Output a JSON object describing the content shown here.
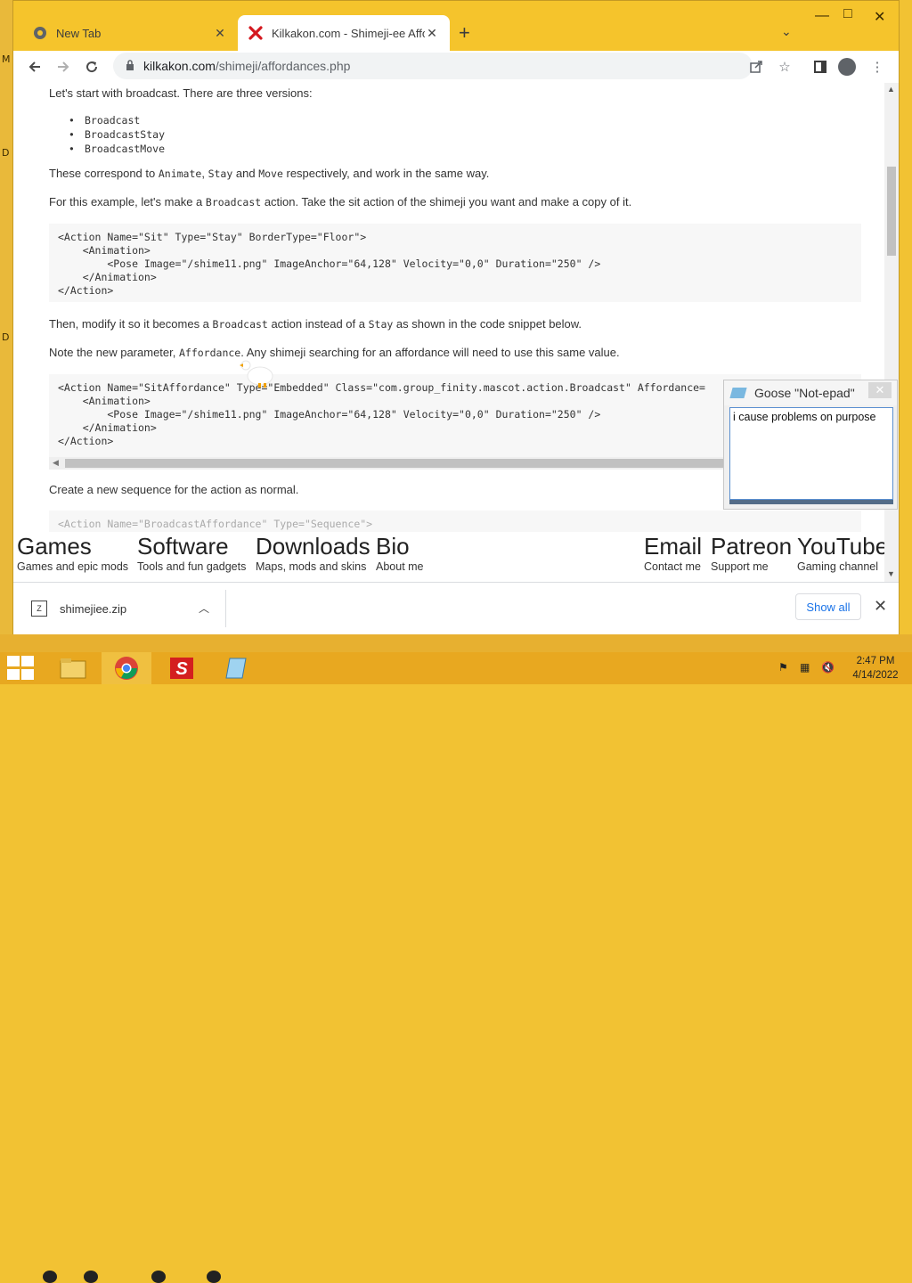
{
  "desktop": {
    "left_letters": [
      "M",
      "D",
      "D"
    ]
  },
  "window": {
    "controls": {
      "minimize": "—",
      "maximize": "□",
      "close": "✕"
    }
  },
  "tabs": [
    {
      "title": "New Tab",
      "favicon": "chrome-icon",
      "close": "✕"
    },
    {
      "title": "Kilkakon.com - Shimeji-ee Affordances",
      "favicon": "kilkakon-x-icon",
      "close": "✕"
    }
  ],
  "new_tab_glyph": "+",
  "tab_search_glyph": "⌄",
  "toolbar": {
    "url_host": "kilkakon.com",
    "url_path": "/shimeji/affordances.php"
  },
  "content": {
    "intro": "Let's start with broadcast. There are three versions:",
    "versions": [
      "Broadcast",
      "BroadcastStay",
      "BroadcastMove"
    ],
    "correspond": {
      "a": "These correspond to ",
      "animate": "Animate",
      "b": ", ",
      "stay": "Stay",
      "c": " and ",
      "move": "Move",
      "d": " respectively, and work in the same way."
    },
    "example": {
      "a": "For this example, let's make a ",
      "broadcast": "Broadcast",
      "b": " action. Take the sit action of the shimeji you want and make a copy of it."
    },
    "code1": "<Action Name=\"Sit\" Type=\"Stay\" BorderType=\"Floor\">\n    <Animation>\n        <Pose Image=\"/shime11.png\" ImageAnchor=\"64,128\" Velocity=\"0,0\" Duration=\"250\" />\n    </Animation>\n</Action>",
    "modify": {
      "a": "Then, modify it so it becomes a ",
      "broadcast": "Broadcast",
      "b": " action instead of a ",
      "stay": "Stay",
      "c": " as shown in the code snippet below."
    },
    "note": {
      "a": "Note the new parameter, ",
      "affordance": "Affordance",
      "b": ". Any shimeji searching for an affordance will need to use this same value."
    },
    "code2": "<Action Name=\"SitAffordance\" Type=\"Embedded\" Class=\"com.group_finity.mascot.action.Broadcast\" Affordance=\n    <Animation>\n        <Pose Image=\"/shime11.png\" ImageAnchor=\"64,128\" Velocity=\"0,0\" Duration=\"250\" />\n    </Animation>\n</Action>",
    "sequence": "Create a new sequence for the action as normal.",
    "code3": "<Action Name=\"BroadcastAffordance\" Type=\"Sequence\">\n    <ActionReference Name=\"SitAffordance\" />"
  },
  "footer_nav": [
    {
      "title": "Games",
      "subtitle": "Games and epic mods"
    },
    {
      "title": "Software",
      "subtitle": "Tools and fun gadgets"
    },
    {
      "title": "Downloads",
      "subtitle": "Maps, mods and skins"
    },
    {
      "title": "Bio",
      "subtitle": "About me"
    },
    {
      "title": "Email",
      "subtitle": "Contact me"
    },
    {
      "title": "Patreon",
      "subtitle": "Support me"
    },
    {
      "title": "YouTube",
      "subtitle": "Gaming channel"
    }
  ],
  "notepad": {
    "title": "Goose \"Not-epad\"",
    "text": "i cause problems on purpose",
    "close": "✕"
  },
  "downloads": {
    "file": "shimejiee.zip",
    "show_all": "Show all",
    "close": "✕"
  },
  "taskbar": {
    "time": "2:47 PM",
    "date": "4/14/2022"
  },
  "colors": {
    "accent": "#f5c42c",
    "link": "#1a73e8",
    "taskbar": "#e8a820"
  }
}
